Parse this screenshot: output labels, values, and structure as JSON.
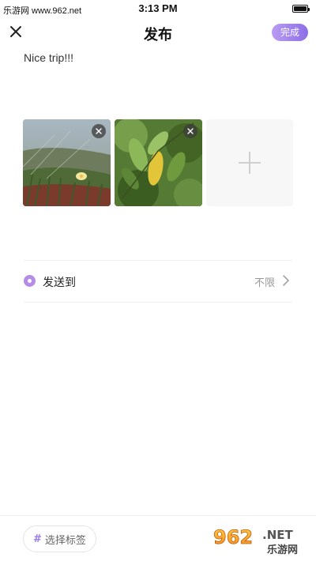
{
  "status_bar": {
    "carrier_text": "乐游网 www.962.net",
    "time": "3:13 PM"
  },
  "header": {
    "title": "发布",
    "done_label": "完成"
  },
  "post": {
    "text": "Nice trip!!!"
  },
  "photos": [
    {
      "subject": "grass-and-flower-photo"
    },
    {
      "subject": "leaves-photo"
    }
  ],
  "send_to": {
    "label": "发送到",
    "value": "不限"
  },
  "bottom": {
    "tag_hash": "#",
    "tag_label": "选择标签"
  },
  "watermark": {
    "logo_text": "962.NET",
    "logo_subtext": "乐游网"
  },
  "colors": {
    "accent": "#9a7de8",
    "done_gradient_start": "#b99cf2",
    "done_gradient_end": "#8c6ee6"
  }
}
